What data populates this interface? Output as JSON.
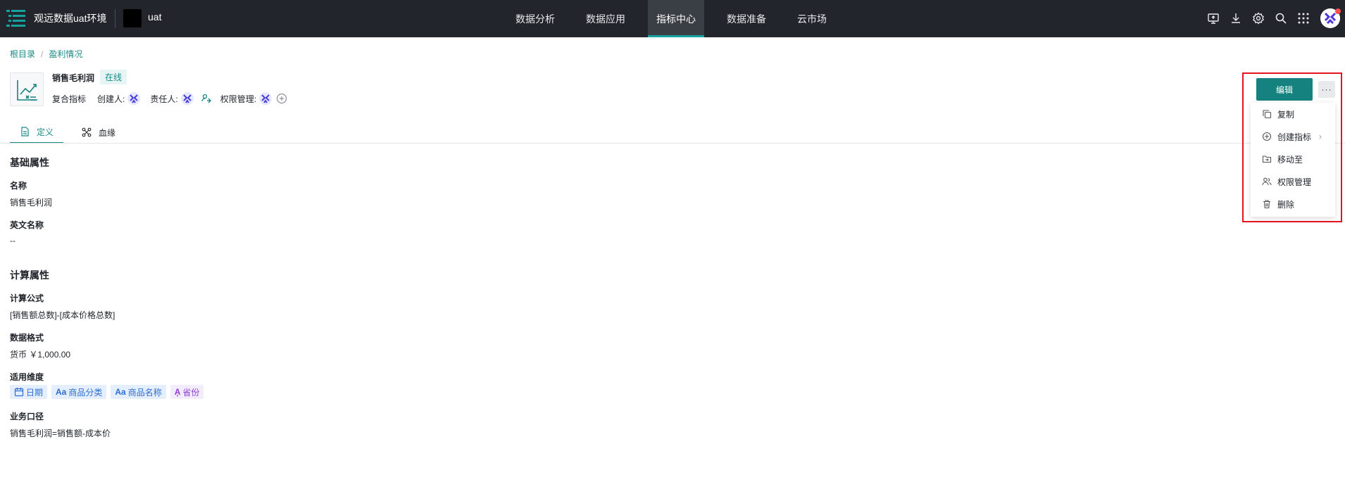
{
  "topbar": {
    "workspace": "观远数据uat环境",
    "project": "uat",
    "nav": [
      {
        "label": "数据分析"
      },
      {
        "label": "数据应用"
      },
      {
        "label": "指标中心"
      },
      {
        "label": "数据准备"
      },
      {
        "label": "云市场"
      }
    ],
    "active_nav": "指标中心",
    "tools": [
      "monitor-upload-icon",
      "download-icon",
      "settings-icon",
      "search-icon",
      "apps-grid-icon"
    ]
  },
  "breadcrumb": {
    "root": "根目录",
    "separator": "/",
    "current": "盈利情况"
  },
  "metric": {
    "title": "销售毛利润",
    "status": "在线",
    "type": "复合指标",
    "creator_label": "创建人:",
    "owner_label": "责任人:",
    "permission_label": "权限管理:"
  },
  "tabs": [
    {
      "label": "定义",
      "active": true
    },
    {
      "label": "血缘",
      "active": false
    }
  ],
  "sections": {
    "basic": {
      "title": "基础属性",
      "name_label": "名称",
      "name_value": "销售毛利润",
      "en_name_label": "英文名称",
      "en_name_value": "--"
    },
    "calc": {
      "title": "计算属性",
      "formula_label": "计算公式",
      "formula_value": "[销售额总数]-[成本价格总数]",
      "format_label": "数据格式",
      "format_value": "货币 ￥1,000.00",
      "dims_label": "适用维度",
      "dims": [
        {
          "label": "日期",
          "icon": "calendar-icon",
          "color": "#2c6fd3"
        },
        {
          "label": "商品分类",
          "icon": "text-field-icon",
          "color": "#2c6fd3"
        },
        {
          "label": "商品名称",
          "icon": "text-field-icon",
          "color": "#2c6fd3"
        },
        {
          "label": "省份",
          "icon": "geo-text-icon",
          "color": "#8a3fd1"
        }
      ],
      "biz_label": "业务口径",
      "biz_value": "销售毛利润=销售额-成本价"
    }
  },
  "actions": {
    "edit_label": "编辑",
    "more_label": "···",
    "menu": [
      {
        "label": "复制",
        "icon": "copy-icon"
      },
      {
        "label": "创建指标",
        "icon": "plus-circle-icon",
        "submenu": true
      },
      {
        "label": "移动至",
        "icon": "folder-move-icon"
      },
      {
        "label": "权限管理",
        "icon": "users-icon"
      },
      {
        "label": "删除",
        "icon": "trash-icon"
      }
    ]
  },
  "colors": {
    "accent": "#16827f",
    "topbar": "#22252b",
    "highlight": "#e5131d"
  }
}
